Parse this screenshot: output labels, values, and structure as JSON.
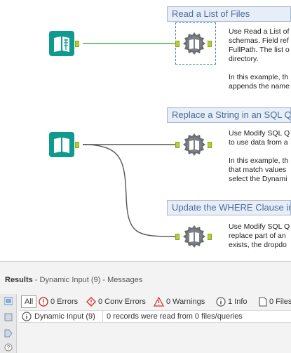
{
  "comments": [
    {
      "title": "Read a List of Files",
      "text": "Use Read a List of\nschemas. Field ref\nFullPath. The list o\ndirectory.\n\nIn this example, th\nappends the name"
    },
    {
      "title": "Replace a String in an SQL Qu",
      "text": "Use Modify SQL Q\nto use data from a\n\nIn this example, th\nthat match values\nselect the Dynami"
    },
    {
      "title": "Update the WHERE Clause in",
      "text": "Use Modify SQL Q\nreplace part of an\nexists, the dropdo"
    }
  ],
  "results": {
    "title": "Results",
    "subtitle": " - Dynamic Input (9) - Messages",
    "tabs": {
      "all": "All",
      "errors": "0 Errors",
      "conv_errors": "0 Conv Errors",
      "warnings": "0 Warnings",
      "info": "1 Info",
      "files": "0 Files"
    },
    "row": {
      "tool": "Dynamic Input (9)",
      "message": "0 records were read from 0 files/queries"
    }
  },
  "icons": {
    "input_tool": "book-icon",
    "macro_tool": "gear-book-icon",
    "info": "info-icon",
    "error": "error-icon",
    "warning": "warning-icon",
    "file": "file-icon"
  },
  "colors": {
    "tool_teal": "#0f9a8f",
    "anchor": "#b5cf3a",
    "wire_green": "#4caf50",
    "wire_gray": "#666666",
    "comment_title": "#4a6c9b",
    "error_red": "#d32f2f"
  }
}
